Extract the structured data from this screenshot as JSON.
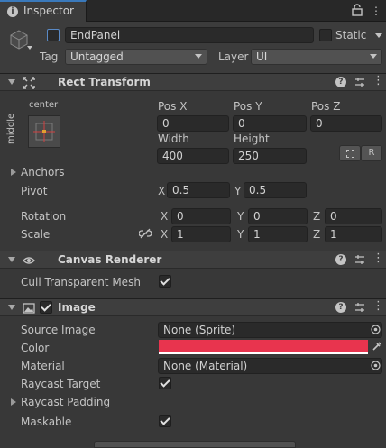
{
  "tab": {
    "title": "Inspector"
  },
  "header": {
    "name": "EndPanel",
    "static_label": "Static",
    "tag_label": "Tag",
    "tag_value": "Untagged",
    "layer_label": "Layer",
    "layer_value": "UI"
  },
  "rect_transform": {
    "title": "Rect Transform",
    "anchor_preset_h": "center",
    "anchor_preset_v": "middle",
    "pos_x_label": "Pos X",
    "pos_x": "0",
    "pos_y_label": "Pos Y",
    "pos_y": "0",
    "pos_z_label": "Pos Z",
    "pos_z": "0",
    "width_label": "Width",
    "width": "400",
    "height_label": "Height",
    "height": "250",
    "r_button": "R",
    "anchors_label": "Anchors",
    "pivot_label": "Pivot",
    "pivot_x": "0.5",
    "pivot_y": "0.5",
    "rotation_label": "Rotation",
    "rot_x": "0",
    "rot_y": "0",
    "rot_z": "0",
    "scale_label": "Scale",
    "scale_x": "1",
    "scale_y": "1",
    "scale_z": "1",
    "x": "X",
    "y": "Y",
    "z": "Z"
  },
  "canvas_renderer": {
    "title": "Canvas Renderer",
    "cull_label": "Cull Transparent Mesh"
  },
  "image": {
    "title": "Image",
    "source_label": "Source Image",
    "source_value": "None (Sprite)",
    "color_label": "Color",
    "color_value": "#e8344e",
    "material_label": "Material",
    "material_value": "None (Material)",
    "raycast_target_label": "Raycast Target",
    "raycast_padding_label": "Raycast Padding",
    "maskable_label": "Maskable"
  },
  "colors": {
    "accent": "#3a79bb",
    "panel": "#383838",
    "field": "#2a2a2a"
  }
}
